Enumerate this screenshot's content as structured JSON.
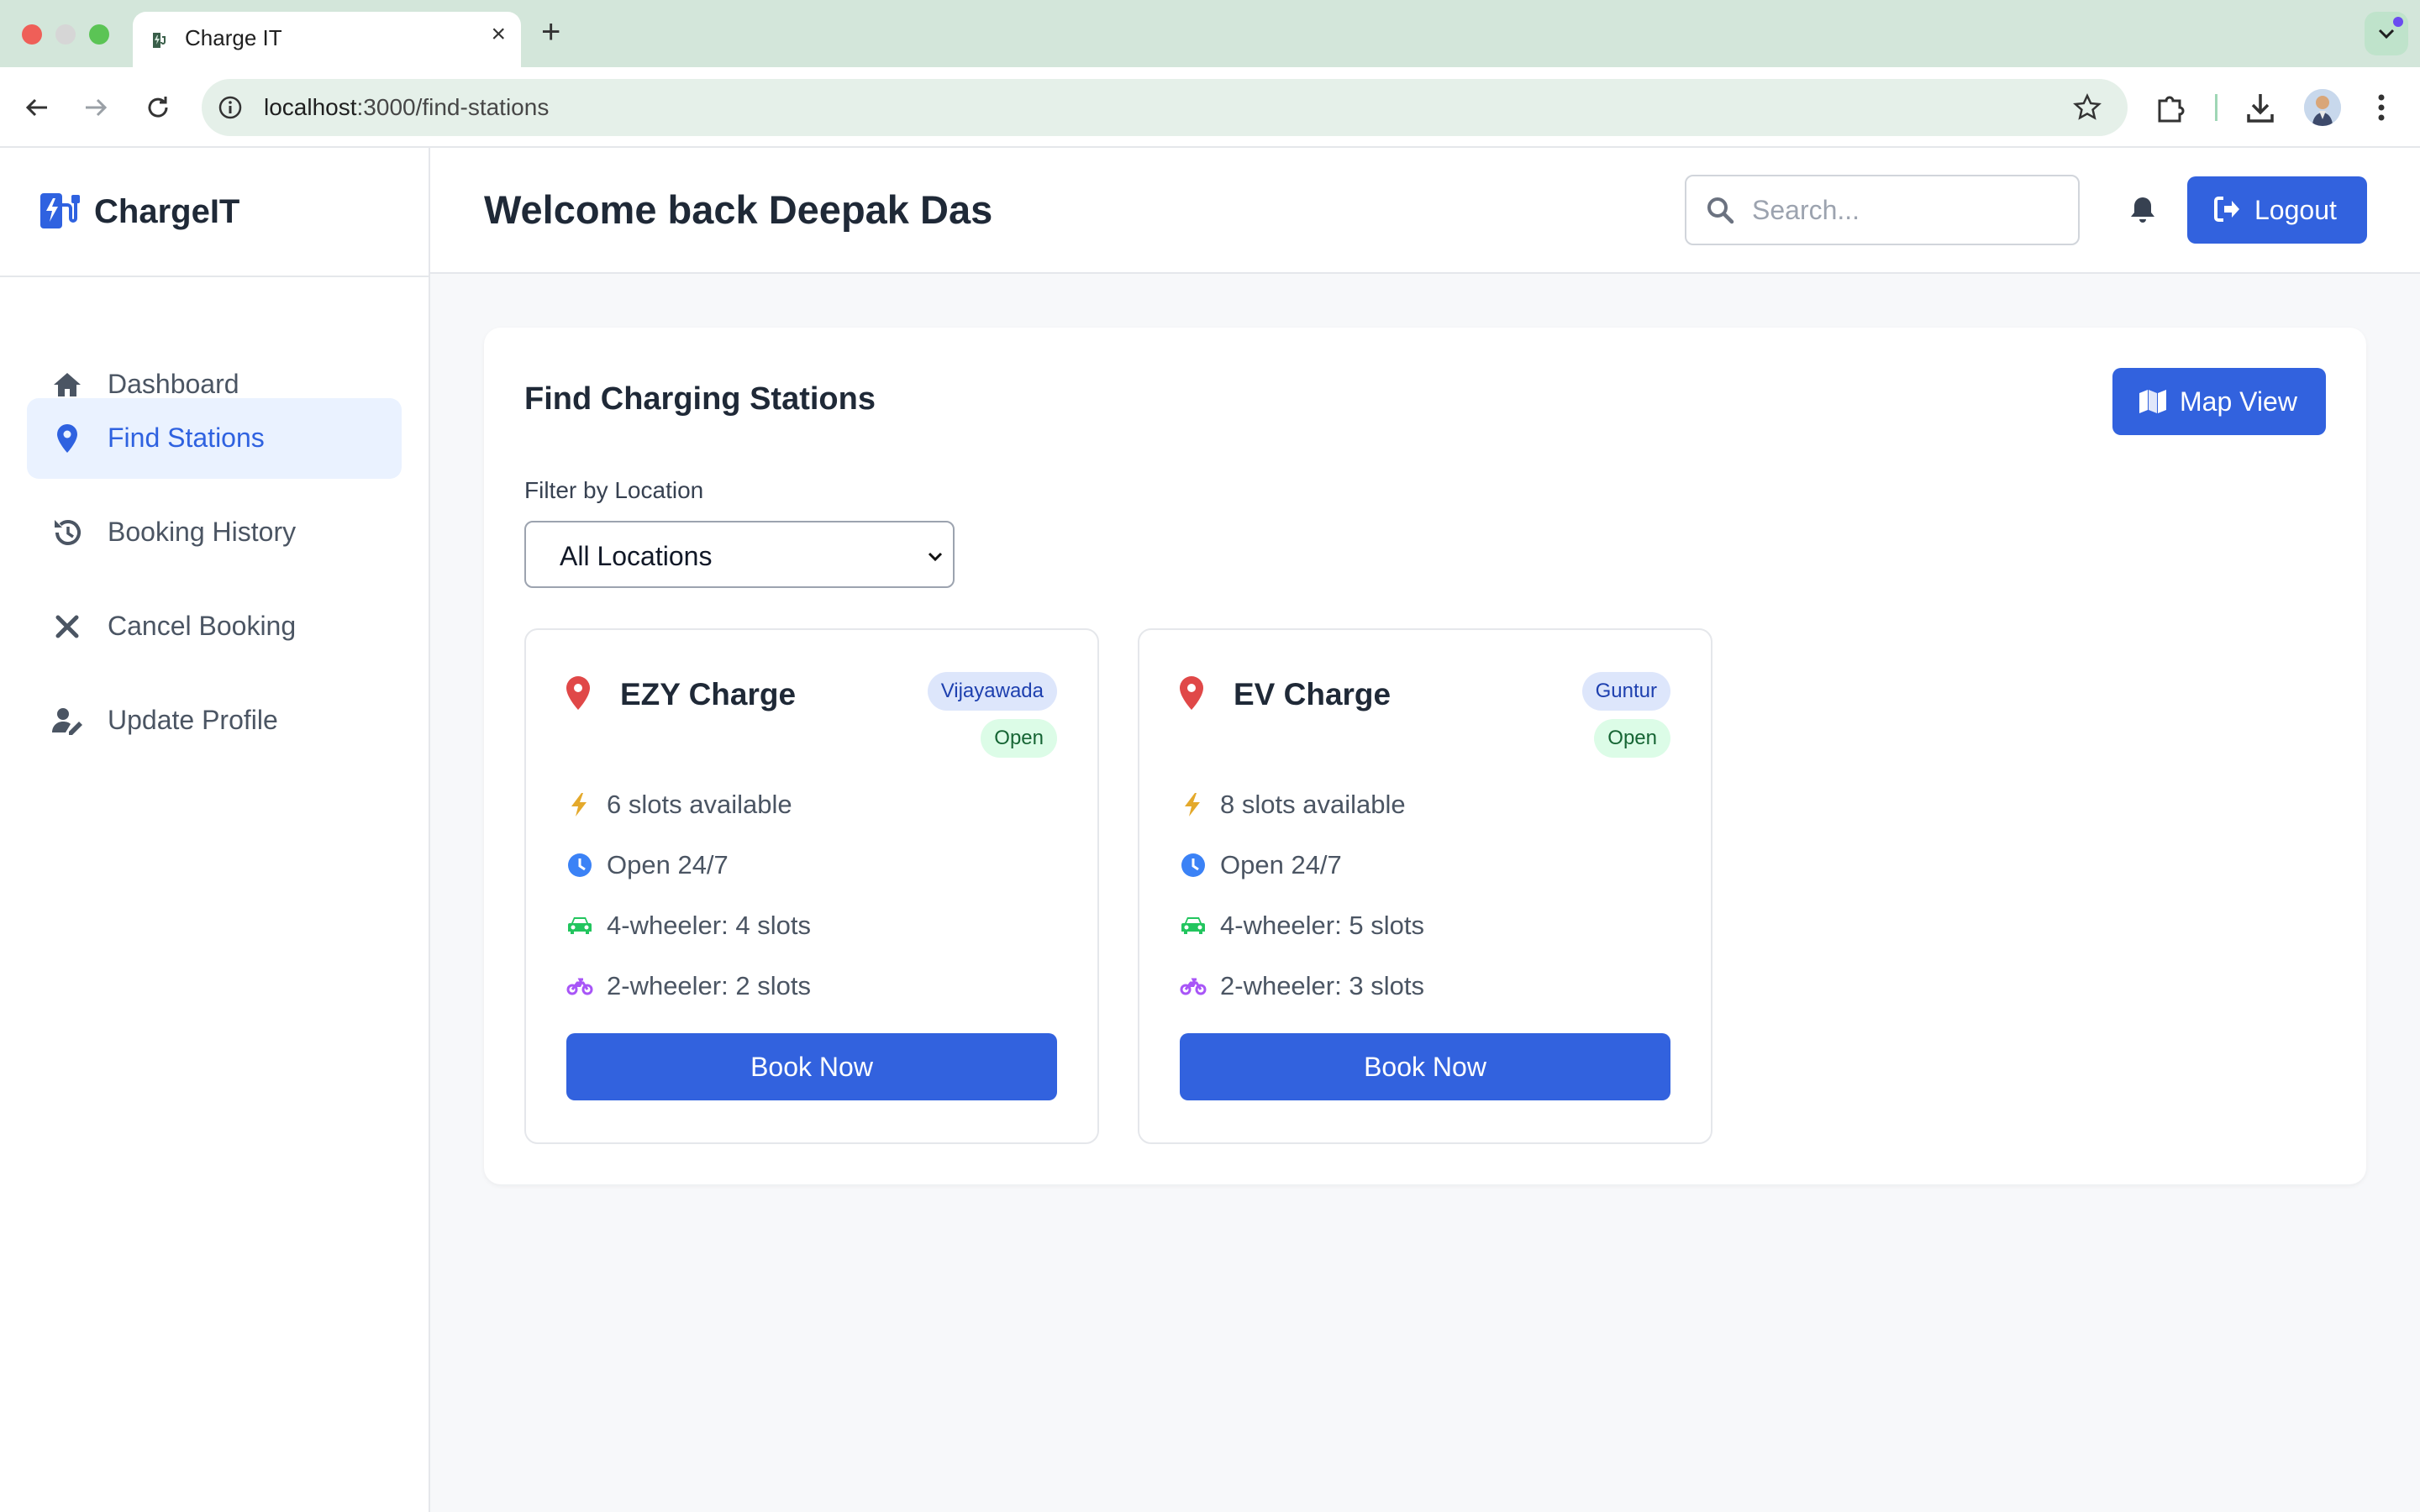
{
  "browser": {
    "tab_title": "Charge IT",
    "url_host": "localhost",
    "url_path": ":3000/find-stations"
  },
  "app": {
    "brand": "ChargeIT",
    "accent_color": "#3262de"
  },
  "sidebar": {
    "items": [
      {
        "label": "Dashboard",
        "icon": "home-icon",
        "active": false
      },
      {
        "label": "Find Stations",
        "icon": "map-pin-icon",
        "active": true
      },
      {
        "label": "Booking History",
        "icon": "history-icon",
        "active": false
      },
      {
        "label": "Cancel Booking",
        "icon": "x-icon",
        "active": false
      },
      {
        "label": "Update Profile",
        "icon": "user-edit-icon",
        "active": false
      }
    ]
  },
  "header": {
    "welcome": "Welcome back Deepak Das",
    "search_placeholder": "Search...",
    "logout_label": "Logout"
  },
  "main": {
    "title": "Find Charging Stations",
    "map_view_label": "Map View",
    "filter_label": "Filter by Location",
    "filter_value": "All Locations"
  },
  "stations": [
    {
      "name": "EZY Charge",
      "location": "Vijayawada",
      "status": "Open",
      "slots": "6 slots available",
      "hours": "Open 24/7",
      "four_wheeler": "4-wheeler: 4 slots",
      "two_wheeler": "2-wheeler: 2 slots",
      "book_label": "Book Now"
    },
    {
      "name": "EV Charge",
      "location": "Guntur",
      "status": "Open",
      "slots": "8 slots available",
      "hours": "Open 24/7",
      "four_wheeler": "4-wheeler: 5 slots",
      "two_wheeler": "2-wheeler: 3 slots",
      "book_label": "Book Now"
    }
  ]
}
